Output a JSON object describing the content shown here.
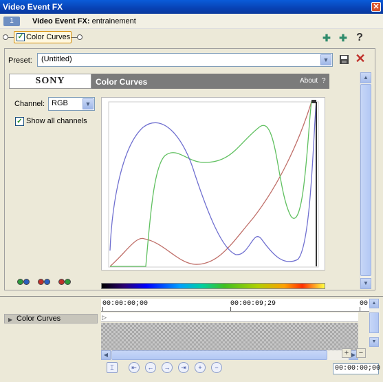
{
  "window": {
    "title": "Video Event FX",
    "close": "✕"
  },
  "fx_header": {
    "track_number": "1",
    "title_bold": "Video Event FX:",
    "title_value": "entrainement"
  },
  "plugin_chain": {
    "plugin_label": "Color Curves",
    "enabled": true,
    "help": "?"
  },
  "preset": {
    "label": "Preset:",
    "value": "(Untitled)"
  },
  "banner": {
    "logo": "SONY",
    "plugin_name": "Color Curves",
    "about": "About",
    "help": "?"
  },
  "controls": {
    "channel_label": "Channel:",
    "channel_value": "RGB",
    "show_all_label": "Show all channels",
    "show_all_checked": true,
    "channel_icons": [
      "G B",
      "R B",
      "R G"
    ]
  },
  "curves": {
    "colors": {
      "red": "#c0706a",
      "green": "#60c060",
      "blue": "#7070d0"
    }
  },
  "timeline": {
    "track_label": "Color Curves",
    "ticks": [
      "00:00:00;00",
      "00:00:09;29",
      "00"
    ],
    "timecode": "00:00:00;00"
  },
  "colors": {
    "titlebar": "#0842b4",
    "accent": "#d38a00",
    "delete": "#c0312b"
  }
}
